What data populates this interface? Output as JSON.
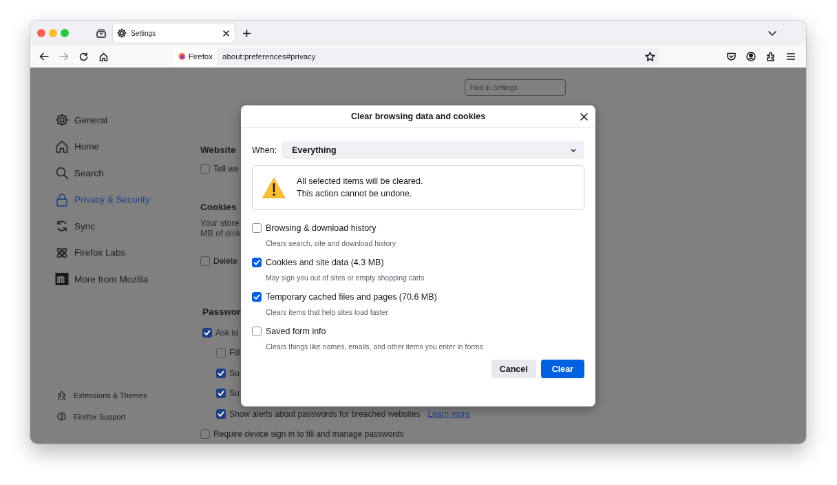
{
  "browser": {
    "tab": {
      "title": "Settings"
    },
    "identity": "Firefox",
    "url": "about:preferences#privacy"
  },
  "settings": {
    "search": {
      "placeholder": "Find in Settings"
    },
    "sidebar": {
      "items": [
        {
          "label": "General",
          "selected": false
        },
        {
          "label": "Home",
          "selected": false
        },
        {
          "label": "Search",
          "selected": false
        },
        {
          "label": "Privacy & Security",
          "selected": true
        },
        {
          "label": "Sync",
          "selected": false
        },
        {
          "label": "Firefox Labs",
          "selected": false
        },
        {
          "label": "More from Mozilla",
          "selected": false
        }
      ],
      "footer": [
        {
          "label": "Extensions & Themes"
        },
        {
          "label": "Firefox Support"
        }
      ]
    },
    "sections": [
      {
        "heading": "Website",
        "items": [
          {
            "kind": "checkbox",
            "label": "Tell we",
            "checked": false
          }
        ]
      },
      {
        "heading": "Cookies",
        "items": [
          {
            "kind": "text",
            "text": "Your store"
          },
          {
            "kind": "text",
            "text": "MB of disk"
          },
          {
            "kind": "checkbox",
            "label": "Delete",
            "checked": false
          }
        ]
      },
      {
        "heading": "Passwor",
        "items": [
          {
            "kind": "checkbox",
            "label": "Ask to",
            "checked": true,
            "children": [
              {
                "kind": "checkbox",
                "label": "Fill",
                "checked": false
              },
              {
                "kind": "checkbox",
                "label": "Su",
                "checked": true
              },
              {
                "kind": "checkbox",
                "label": "Su",
                "checked": true
              },
              {
                "kind": "checkbox",
                "label": "Show alerts about passwords for breached websites",
                "checked": true,
                "link": "Learn more"
              }
            ]
          },
          {
            "kind": "checkbox",
            "label": "Require device sign in to fill and manage passwords",
            "checked": false
          }
        ]
      }
    ]
  },
  "dialog": {
    "title": "Clear browsing data and cookies",
    "when": {
      "label": "When:",
      "value": "Everything"
    },
    "warning": [
      "All selected items will be cleared.",
      "This action cannot be undone."
    ],
    "options": [
      {
        "label": "Browsing & download history",
        "description": "Clears search, site and download history",
        "checked": false
      },
      {
        "label": "Cookies and site data (4.3 MB)",
        "description": "May sign you out of sites or empty shopping carts",
        "checked": true
      },
      {
        "label": "Temporary cached files and pages (70.6 MB)",
        "description": "Clears items that help sites load faster",
        "checked": true
      },
      {
        "label": "Saved form info",
        "description": "Clears things like names, emails, and other items you enter in forms",
        "checked": false
      }
    ],
    "buttons": [
      {
        "label": "Cancel",
        "kind": "secondary"
      },
      {
        "label": "Clear",
        "kind": "primary"
      }
    ]
  }
}
